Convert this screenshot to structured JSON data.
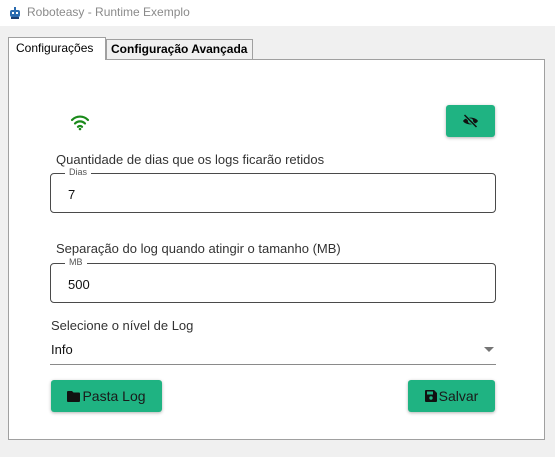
{
  "window": {
    "title": "Roboteasy - Runtime Exemplo",
    "app_icon": "robot-icon"
  },
  "tabs": [
    {
      "label": "Configurações",
      "active": true
    },
    {
      "label": "Configuração Avançada",
      "active": false
    }
  ],
  "status": {
    "connection_icon": "wifi-icon",
    "connection_color": "#1a8a1a"
  },
  "visibility_button": {
    "icon": "eye-off-icon"
  },
  "log_retention": {
    "label": "Quantidade de dias que os logs ficarão retidos",
    "field_legend": "Dias",
    "value": "7"
  },
  "log_split": {
    "label": "Separação do log quando atingir o tamanho (MB)",
    "field_legend": "MB",
    "value": "500"
  },
  "log_level": {
    "label": "Selecione o nível de Log",
    "selected": "Info"
  },
  "buttons": {
    "folder_label": "Pasta Log",
    "folder_icon": "folder-icon",
    "save_label": "Salvar",
    "save_icon": "floppy-disk-icon"
  },
  "colors": {
    "accent": "#1fb382"
  }
}
